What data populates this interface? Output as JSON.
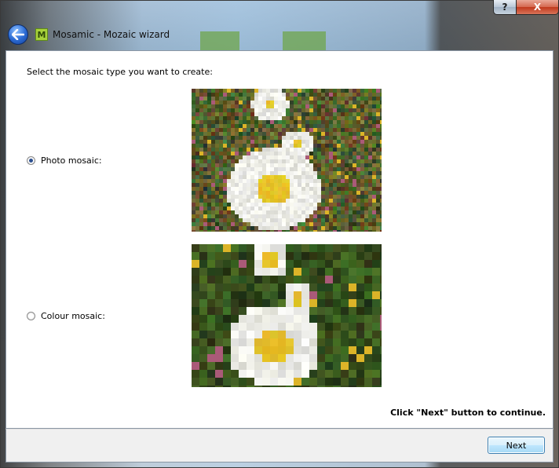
{
  "window": {
    "title": "Mosamic - Mozaic wizard",
    "app_icon_letter": "M",
    "help_glyph": "?",
    "close_glyph": "X"
  },
  "content": {
    "prompt": "Select the mosaic type you want to create:",
    "options": [
      {
        "label": "Photo mosaic:",
        "selected": true
      },
      {
        "label": "Colour mosaic:",
        "selected": false
      }
    ],
    "hint": "Click \"Next\" button to continue."
  },
  "footer": {
    "next_label": "Next"
  },
  "colors": {
    "accent": "#3c7fb1",
    "daisy_center": "#f1b82c",
    "foliage": "#2f5a1f"
  }
}
